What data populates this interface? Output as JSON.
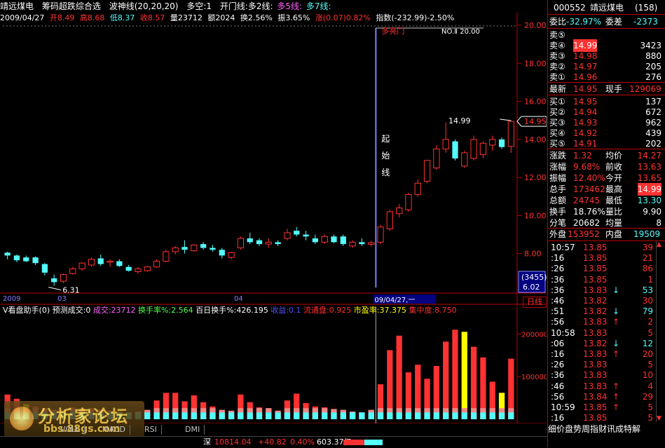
{
  "title": {
    "stock_name": "靖远煤电",
    "indicator": "筹码超跌综合选",
    "wave": "波神线(20,20,20)",
    "longshort": "多空:1",
    "open_line": "开门线:多2线:",
    "line5": "多5线:",
    "line7": "多7线:"
  },
  "info": {
    "date": "2009/04/27",
    "open": "开8.49",
    "high": "高8.68",
    "low": "低8.37",
    "close": "收8.57",
    "volume": "量23712",
    "amount": "额2024",
    "turnover": "换2.56%",
    "amplitude": "振3.65%",
    "change": "涨(0.07)0.82%",
    "index": "指数(-232.99)-2.50%"
  },
  "price_axis": [
    "20.00",
    "18.00",
    "16.00",
    "14.00",
    "12.00",
    "10.00",
    "8.00"
  ],
  "price_axis_values": [
    20,
    18,
    16,
    14,
    12,
    10,
    8
  ],
  "current_price_tag": "14.95",
  "cursor_box": {
    "line1": "(3455)",
    "line2": "6.02"
  },
  "annotations": {
    "low_label": "6.31",
    "high_label": "14.99",
    "trend_label": "多亮门",
    "no_label": "NO.Ⅱ 20.00",
    "start_line": [
      "起",
      "始",
      "线"
    ],
    "date_cursor": "09/04/27,一"
  },
  "date_axis": {
    "d1": "2009",
    "d2": "03",
    "d3": "04"
  },
  "volume_header": {
    "name": "V看盘助手(0)",
    "forecast": "预测成交:0",
    "deal": "成交:23712",
    "turnover": "换手率%:2.564",
    "hundred": "百日换手%:426.195",
    "profit": "收益:0.1",
    "float": "流通盘:0.925",
    "pe": "市盈率:37.375",
    "concentration": "集中度:8.750"
  },
  "vol_axis": [
    "200000",
    "100000"
  ],
  "day_button": "日线",
  "bottom_tabs": [
    "VOLL",
    "MACD",
    "RSI",
    "DMI"
  ],
  "status": {
    "market": "深",
    "index_value": "10814.04",
    "index_change": "+40.82",
    "ratio": "0.40%",
    "amount": "603.37亿"
  },
  "logo": {
    "t1": "分析家论坛",
    "t2": "bbs.88gs.com"
  },
  "quote": {
    "code": "000552",
    "name": "靖远煤电",
    "num": "(158)",
    "ratio_label": "委比",
    "ratio_value": "-32.97%",
    "diff_label": "委差",
    "diff_value": "-2373",
    "asks": [
      {
        "label": "卖⑤",
        "price": "",
        "vol": ""
      },
      {
        "label": "卖④",
        "price": "14.99",
        "vol": "3423"
      },
      {
        "label": "卖③",
        "price": "14.98",
        "vol": "880"
      },
      {
        "label": "卖②",
        "price": "14.97",
        "vol": "205"
      },
      {
        "label": "卖①",
        "price": "14.96",
        "vol": "276"
      }
    ],
    "last_label": "最新",
    "last_value": "14.95",
    "hand_label": "现手",
    "hand_value": "129069",
    "bids": [
      {
        "label": "买①",
        "price": "14.95",
        "vol": "137"
      },
      {
        "label": "买②",
        "price": "14.94",
        "vol": "672"
      },
      {
        "label": "买③",
        "price": "14.93",
        "vol": "962"
      },
      {
        "label": "买④",
        "price": "14.92",
        "vol": "439"
      },
      {
        "label": "买⑤",
        "price": "14.91",
        "vol": "202"
      }
    ],
    "stats": [
      {
        "l1": "涨跌",
        "v1": "1.32",
        "l2": "均价",
        "v2": "14.27"
      },
      {
        "l1": "涨幅",
        "v1": "9.68%",
        "l2": "前收",
        "v2": "13.63"
      },
      {
        "l1": "振幅",
        "v1": "12.40%",
        "l2": "今开",
        "v2": "13.65"
      },
      {
        "l1": "总手",
        "v1": "173462",
        "l2": "最高",
        "v2": "14.99"
      },
      {
        "l1": "总额",
        "v1": "24745",
        "l2": "最低",
        "v2": "13.30"
      },
      {
        "l1": "换手",
        "v1": "18.76%",
        "l2": "量比",
        "v2": "9.90"
      },
      {
        "l1": "分笔",
        "v1": "20682",
        "l2": "均量",
        "v2": "8"
      }
    ],
    "outer_label": "外盘",
    "outer_value": "153952",
    "inner_label": "内盘",
    "inner_value": "19509"
  },
  "ticks": [
    {
      "time": "10:57",
      "price": "13.85",
      "arrow": "",
      "vol": "39"
    },
    {
      "time": ":16",
      "price": "13.85",
      "arrow": "",
      "vol": "21"
    },
    {
      "time": ":26",
      "price": "13.85",
      "arrow": "",
      "vol": "86"
    },
    {
      "time": ":36",
      "price": "13.85",
      "arrow": "",
      "vol": "1"
    },
    {
      "time": ":36",
      "price": "13.83",
      "arrow": "↓",
      "vol": "53"
    },
    {
      "time": ":46",
      "price": "13.82",
      "arrow": "",
      "vol": "30"
    },
    {
      "time": ":51",
      "price": "13.82",
      "arrow": "↓",
      "vol": "79"
    },
    {
      "time": ":56",
      "price": "13.83",
      "arrow": "↑",
      "vol": "2"
    },
    {
      "time": "10:58",
      "price": "13.83",
      "arrow": "",
      "vol": "5"
    },
    {
      "time": ":06",
      "price": "13.82",
      "arrow": "↓",
      "vol": "12"
    },
    {
      "time": ":16",
      "price": "13.83",
      "arrow": "↑",
      "vol": "20"
    },
    {
      "time": ":26",
      "price": "13.83",
      "arrow": "",
      "vol": "5"
    },
    {
      "time": ":36",
      "price": "13.83",
      "arrow": "",
      "vol": "10"
    },
    {
      "time": ":46",
      "price": "13.83",
      "arrow": "↑",
      "vol": "4"
    },
    {
      "time": ":56",
      "price": "13.84",
      "arrow": "↑",
      "vol": "29"
    },
    {
      "time": "10:59",
      "price": "13.85",
      "arrow": "↑",
      "vol": "5"
    },
    {
      "time": ":16",
      "price": "13.85",
      "arrow": "",
      "vol": "5"
    }
  ],
  "bottom_menu": "细价盘势周指财讯成特解",
  "colors": {
    "up": "#ff3232",
    "down": "#54fcfc",
    "yellow": "#ffff00",
    "white": "#ffffff",
    "purple": "#8080ff"
  },
  "chart_data": {
    "type": "candlestick",
    "price_range": [
      6,
      20
    ],
    "volume_range": [
      0,
      240000
    ],
    "candles": [
      [
        8.05,
        8.1,
        7.7,
        7.9
      ],
      [
        7.9,
        7.95,
        7.55,
        7.65
      ],
      [
        7.8,
        7.9,
        7.55,
        7.6
      ],
      [
        7.8,
        7.85,
        7.4,
        7.5
      ],
      [
        7.45,
        7.5,
        6.85,
        7.0
      ],
      [
        6.7,
        6.9,
        6.31,
        6.5
      ],
      [
        6.55,
        6.95,
        6.45,
        6.9
      ],
      [
        6.95,
        7.3,
        6.9,
        7.2
      ],
      [
        7.2,
        7.55,
        7.1,
        7.5
      ],
      [
        7.4,
        7.8,
        7.3,
        7.7
      ],
      [
        7.75,
        7.95,
        7.35,
        7.45
      ],
      [
        7.55,
        7.7,
        7.3,
        7.6
      ],
      [
        7.6,
        7.7,
        7.3,
        7.35
      ],
      [
        7.3,
        7.4,
        7.05,
        7.1
      ],
      [
        7.05,
        7.3,
        6.95,
        7.2
      ],
      [
        7.1,
        7.35,
        7.05,
        7.3
      ],
      [
        7.3,
        7.7,
        7.25,
        7.6
      ],
      [
        7.6,
        8.2,
        7.55,
        8.1
      ],
      [
        8.1,
        8.4,
        7.95,
        8.3
      ],
      [
        8.35,
        8.7,
        8.0,
        8.2
      ],
      [
        8.15,
        8.5,
        8.1,
        8.45
      ],
      [
        8.5,
        8.6,
        8.2,
        8.3
      ],
      [
        8.3,
        8.45,
        8.1,
        8.2
      ],
      [
        8.2,
        8.3,
        7.75,
        7.9
      ],
      [
        7.8,
        8.1,
        7.7,
        8.05
      ],
      [
        8.3,
        8.9,
        8.2,
        8.8
      ],
      [
        8.8,
        9.1,
        8.5,
        8.6
      ],
      [
        8.7,
        8.8,
        8.4,
        8.5
      ],
      [
        8.5,
        8.8,
        8.3,
        8.6
      ],
      [
        8.6,
        8.7,
        8.4,
        8.5
      ],
      [
        8.8,
        9.3,
        8.7,
        9.1
      ],
      [
        9.2,
        9.4,
        8.9,
        9.0
      ],
      [
        9.0,
        9.2,
        8.7,
        8.9
      ],
      [
        8.8,
        9.0,
        8.5,
        8.6
      ],
      [
        8.6,
        9.0,
        8.5,
        8.9
      ],
      [
        8.9,
        9.0,
        8.55,
        8.6
      ],
      [
        8.9,
        9.0,
        8.4,
        8.5
      ],
      [
        8.4,
        8.7,
        8.3,
        8.6
      ],
      [
        8.6,
        8.8,
        8.4,
        8.5
      ],
      [
        8.49,
        8.68,
        8.37,
        8.57
      ],
      [
        8.6,
        9.5,
        8.5,
        9.4
      ],
      [
        9.3,
        10.3,
        9.2,
        10.2
      ],
      [
        10.1,
        10.6,
        9.9,
        10.4
      ],
      [
        10.3,
        11.2,
        10.2,
        11.1
      ],
      [
        11.1,
        11.9,
        11.0,
        11.7
      ],
      [
        11.8,
        12.9,
        11.7,
        12.9
      ],
      [
        12.5,
        13.7,
        12.4,
        13.5
      ],
      [
        13.5,
        14.9,
        13.3,
        14.0
      ],
      [
        13.9,
        14.0,
        12.9,
        13.0
      ],
      [
        12.6,
        13.4,
        12.5,
        13.3
      ],
      [
        13.0,
        14.2,
        12.9,
        14.0
      ],
      [
        13.2,
        13.9,
        13.0,
        13.8
      ],
      [
        13.7,
        14.2,
        13.4,
        14.0
      ],
      [
        14.0,
        14.1,
        13.5,
        13.6
      ],
      [
        13.63,
        14.99,
        13.3,
        14.95
      ]
    ],
    "volumes": [
      {
        "v": 58000,
        "c": "r"
      },
      {
        "v": 48000,
        "c": "r"
      },
      {
        "v": 35000,
        "c": "y"
      },
      {
        "v": 30000,
        "c": "r"
      },
      {
        "v": 26000,
        "c": "c"
      },
      {
        "v": 22000,
        "c": "r"
      },
      {
        "v": 20000,
        "c": "r"
      },
      {
        "v": 28000,
        "c": "r"
      },
      {
        "v": 24000,
        "c": "r"
      },
      {
        "v": 26000,
        "c": "r"
      },
      {
        "v": 22000,
        "c": "r"
      },
      {
        "v": 20000,
        "c": "r"
      },
      {
        "v": 18000,
        "c": "r"
      },
      {
        "v": 16000,
        "c": "r"
      },
      {
        "v": 18000,
        "c": "r"
      },
      {
        "v": 22000,
        "c": "r"
      },
      {
        "v": 44000,
        "c": "r"
      },
      {
        "v": 62000,
        "c": "r"
      },
      {
        "v": 62000,
        "c": "r"
      },
      {
        "v": 42000,
        "c": "r"
      },
      {
        "v": 56000,
        "c": "r"
      },
      {
        "v": 40000,
        "c": "r"
      },
      {
        "v": 30000,
        "c": "r"
      },
      {
        "v": 22000,
        "c": "r"
      },
      {
        "v": 20000,
        "c": "r"
      },
      {
        "v": 58000,
        "c": "r"
      },
      {
        "v": 40000,
        "c": "r"
      },
      {
        "v": 28000,
        "c": "r"
      },
      {
        "v": 26000,
        "c": "r"
      },
      {
        "v": 20000,
        "c": "r"
      },
      {
        "v": 44000,
        "c": "r"
      },
      {
        "v": 60000,
        "c": "r"
      },
      {
        "v": 38000,
        "c": "r"
      },
      {
        "v": 30000,
        "c": "r"
      },
      {
        "v": 28000,
        "c": "r"
      },
      {
        "v": 24000,
        "c": "r"
      },
      {
        "v": 22000,
        "c": "r"
      },
      {
        "v": 18000,
        "c": "r"
      },
      {
        "v": 16000,
        "c": "r"
      },
      {
        "v": 22000,
        "c": "r"
      },
      {
        "v": 82000,
        "c": "r"
      },
      {
        "v": 162000,
        "c": "r"
      },
      {
        "v": 196000,
        "c": "r"
      },
      {
        "v": 110000,
        "c": "r"
      },
      {
        "v": 128000,
        "c": "r"
      },
      {
        "v": 95000,
        "c": "r"
      },
      {
        "v": 125000,
        "c": "r"
      },
      {
        "v": 182000,
        "c": "r"
      },
      {
        "v": 210000,
        "c": "r"
      },
      {
        "v": 205000,
        "c": "y"
      },
      {
        "v": 170000,
        "c": "r"
      },
      {
        "v": 145000,
        "c": "r"
      },
      {
        "v": 88000,
        "c": "r"
      },
      {
        "v": 62000,
        "c": "y"
      },
      {
        "v": 142000,
        "c": "r"
      }
    ]
  }
}
